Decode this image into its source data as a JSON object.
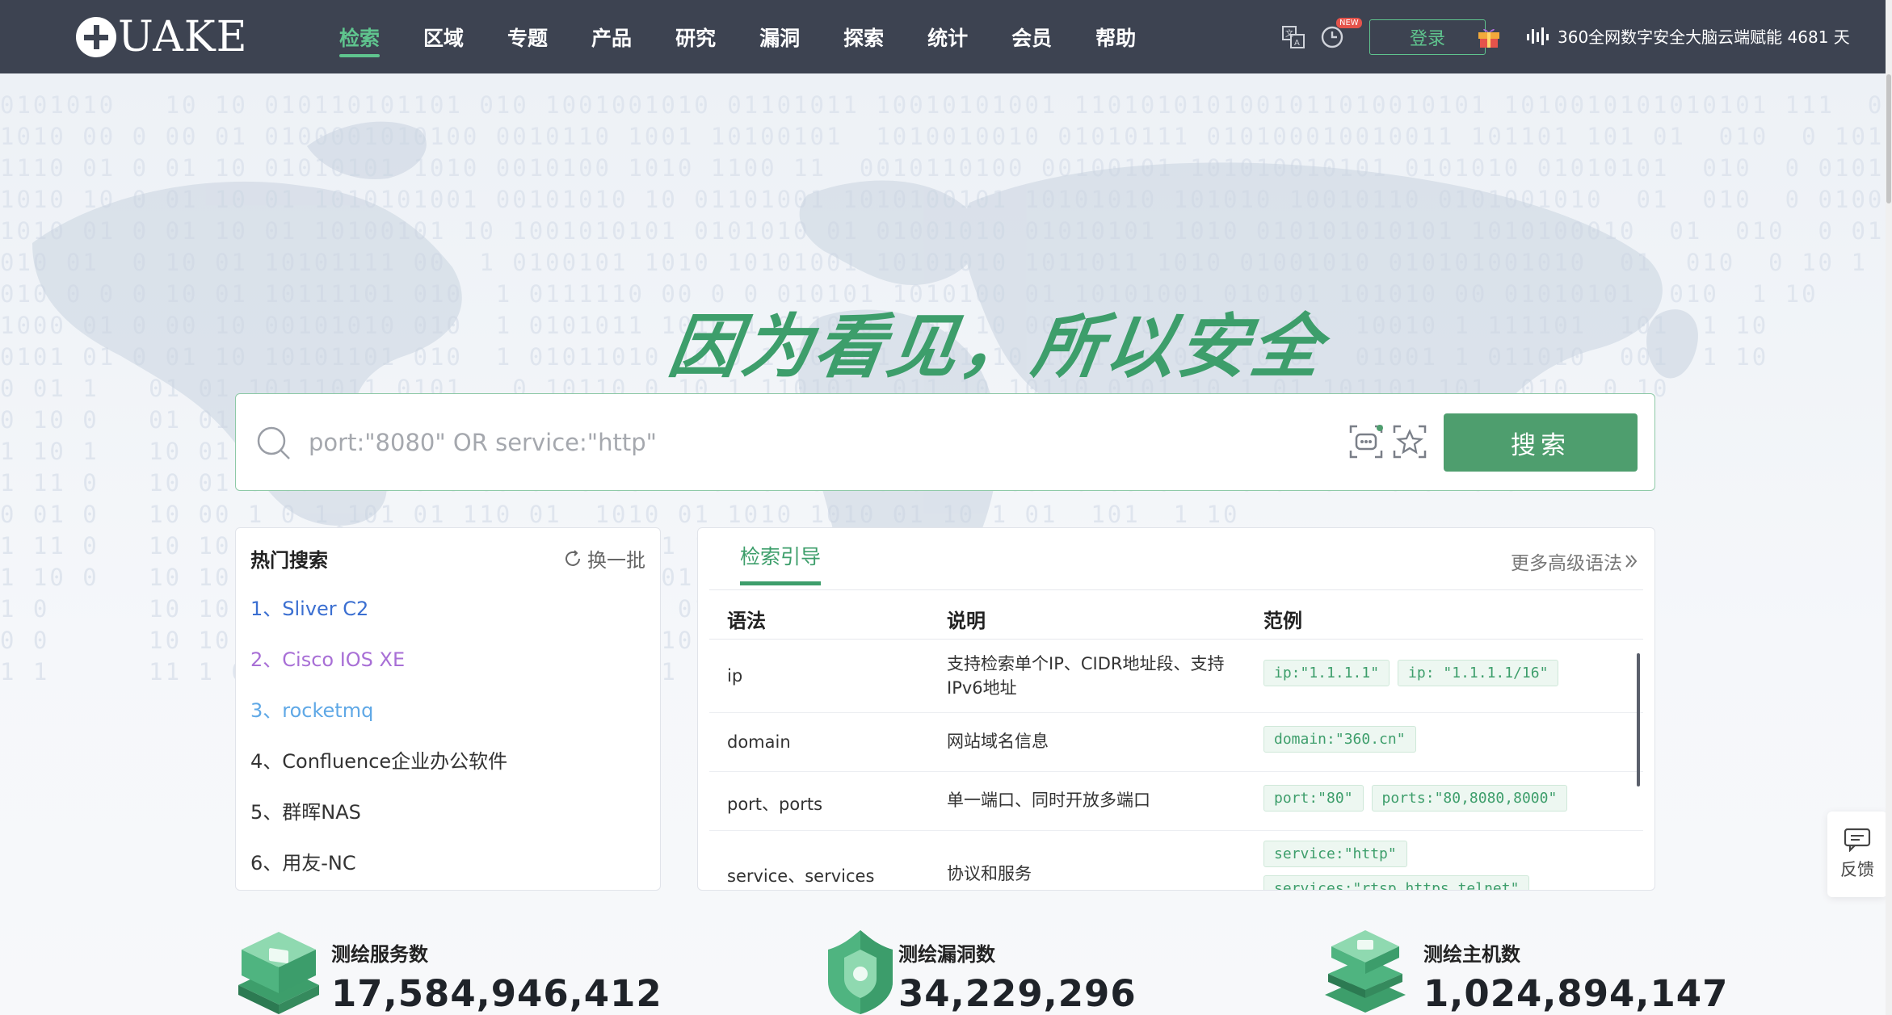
{
  "header": {
    "logo_text": "UAKE",
    "nav": [
      "检索",
      "区域",
      "专题",
      "产品",
      "研究",
      "漏洞",
      "探索",
      "统计",
      "会员",
      "帮助"
    ],
    "new_badge": "NEW",
    "login_label": "登录",
    "ticker_text": "360全网数字安全大脑云端赋能 4681 天"
  },
  "hero": {
    "slogan": "因为看见，所以安全"
  },
  "search": {
    "placeholder": "port:\"8080\" OR service:\"http\"",
    "button_label": "搜索"
  },
  "hot": {
    "title": "热门搜索",
    "refresh_label": "换一批",
    "items": [
      {
        "text": "1、Sliver C2",
        "color": "#3b6fd1"
      },
      {
        "text": "2、Cisco IOS XE",
        "color": "#a86fd6"
      },
      {
        "text": "3、rocketmq",
        "color": "#5fa8e6"
      },
      {
        "text": "4、Confluence企业办公软件",
        "color": "#333333"
      },
      {
        "text": "5、群晖NAS",
        "color": "#333333"
      },
      {
        "text": "6、用友-NC",
        "color": "#333333"
      }
    ]
  },
  "guide": {
    "tab_label": "检索引导",
    "more_label": "更多高级语法",
    "columns": [
      "语法",
      "说明",
      "范例"
    ],
    "rows": [
      {
        "syntax": "ip",
        "desc": "支持检索单个IP、CIDR地址段、支持IPv6地址",
        "examples": [
          "ip:\"1.1.1.1\"",
          "ip: \"1.1.1.1/16\""
        ]
      },
      {
        "syntax": "domain",
        "desc": "网站域名信息",
        "examples": [
          "domain:\"360.cn\""
        ]
      },
      {
        "syntax": "port、ports",
        "desc": "单一端口、同时开放多端口",
        "examples": [
          "port:\"80\"",
          "ports:\"80,8080,8000\""
        ]
      },
      {
        "syntax": "service、services",
        "desc": "协议和服务",
        "examples": [
          "service:\"http\"",
          "services:\"rtsp,https,telnet\""
        ]
      }
    ]
  },
  "stats": [
    {
      "label": "测绘服务数",
      "value": "17,584,946,412"
    },
    {
      "label": "测绘漏洞数",
      "value": "34,229,296"
    },
    {
      "label": "测绘主机数",
      "value": "1,024,894,147"
    }
  ],
  "feedback_label": "反馈",
  "colors": {
    "header_bg": "#3d4351",
    "accent": "#4e9e6e",
    "accent_light": "#5fc48e"
  }
}
